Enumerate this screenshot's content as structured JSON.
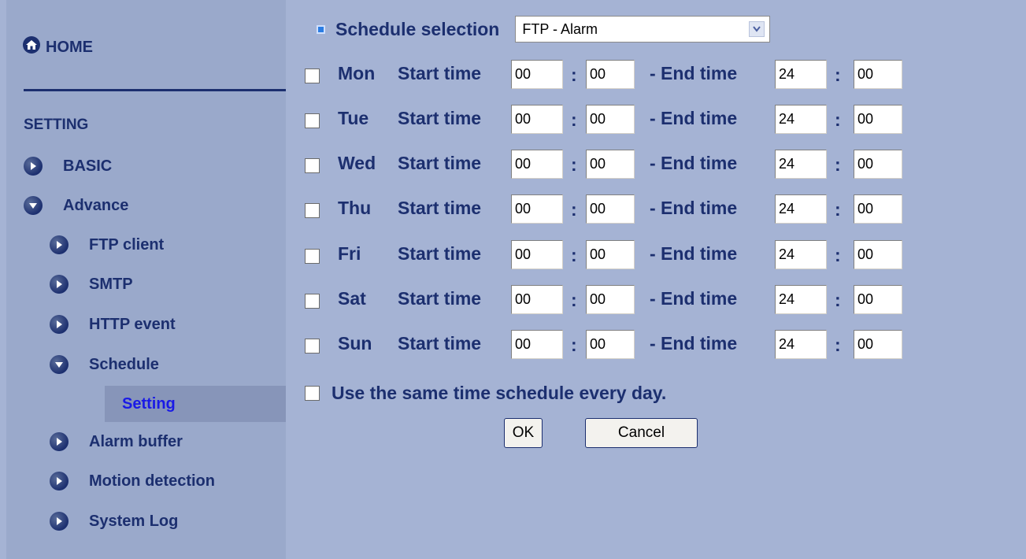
{
  "sidebar": {
    "home_label": "HOME",
    "section_title": "SETTING",
    "items": [
      {
        "label": "BASIC",
        "icon": "arrow-right-icon"
      },
      {
        "label": "Advance",
        "icon": "arrow-down-icon"
      },
      {
        "label": "FTP client",
        "icon": "arrow-right-icon"
      },
      {
        "label": "SMTP",
        "icon": "arrow-right-icon"
      },
      {
        "label": "HTTP event",
        "icon": "arrow-right-icon"
      },
      {
        "label": "Schedule",
        "icon": "arrow-down-icon"
      },
      {
        "label": "Setting",
        "selected": true
      },
      {
        "label": "Alarm buffer",
        "icon": "arrow-right-icon"
      },
      {
        "label": "Motion detection",
        "icon": "arrow-right-icon"
      },
      {
        "label": "System Log",
        "icon": "arrow-right-icon"
      }
    ]
  },
  "schedule": {
    "label": "Schedule selection",
    "selected": "FTP - Alarm",
    "start_label": "Start time",
    "end_label": "- End time",
    "colon": ":",
    "days": [
      {
        "name": "Mon",
        "start_h": "00",
        "start_m": "00",
        "end_h": "24",
        "end_m": "00"
      },
      {
        "name": "Tue",
        "start_h": "00",
        "start_m": "00",
        "end_h": "24",
        "end_m": "00"
      },
      {
        "name": "Wed",
        "start_h": "00",
        "start_m": "00",
        "end_h": "24",
        "end_m": "00"
      },
      {
        "name": "Thu",
        "start_h": "00",
        "start_m": "00",
        "end_h": "24",
        "end_m": "00"
      },
      {
        "name": "Fri",
        "start_h": "00",
        "start_m": "00",
        "end_h": "24",
        "end_m": "00"
      },
      {
        "name": "Sat",
        "start_h": "00",
        "start_m": "00",
        "end_h": "24",
        "end_m": "00"
      },
      {
        "name": "Sun",
        "start_h": "00",
        "start_m": "00",
        "end_h": "24",
        "end_m": "00"
      }
    ],
    "same_every_day": "Use the same time schedule every day."
  },
  "buttons": {
    "ok": "OK",
    "cancel": "Cancel"
  },
  "colors": {
    "background": "#a5b3d4",
    "sidebar": "#9aa9cb",
    "text": "#1c2f6f",
    "selected_link": "#1a1ae6"
  }
}
